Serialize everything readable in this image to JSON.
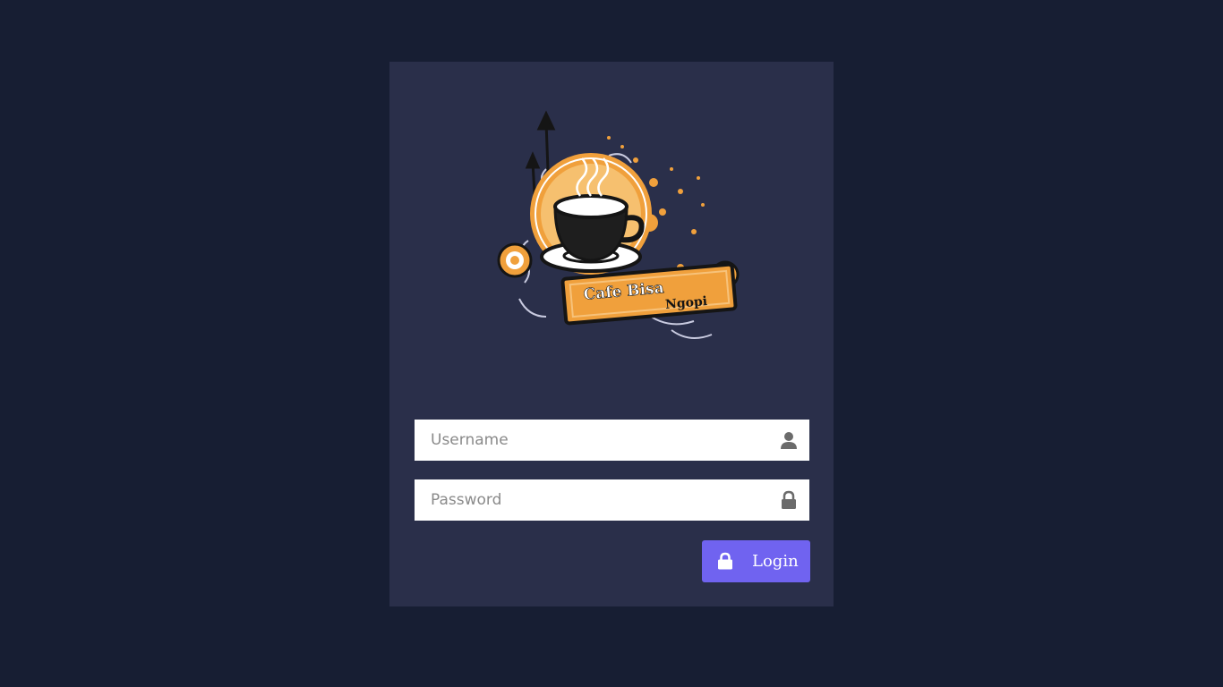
{
  "logo": {
    "line1": "Cafe Bisa",
    "line2": "Ngopi",
    "icon": "coffee-cup-icon"
  },
  "form": {
    "username": {
      "placeholder": "Username",
      "value": "",
      "icon": "user-icon"
    },
    "password": {
      "placeholder": "Password",
      "value": "",
      "icon": "lock-icon"
    },
    "submit": {
      "label": "Login",
      "icon": "lock-icon"
    }
  },
  "colors": {
    "page_background": "#171e33",
    "card_background": "#2a2f4a",
    "button": "#7063f0",
    "logo_orange": "#f0a03c",
    "icon_gray": "#6b6b6b"
  }
}
